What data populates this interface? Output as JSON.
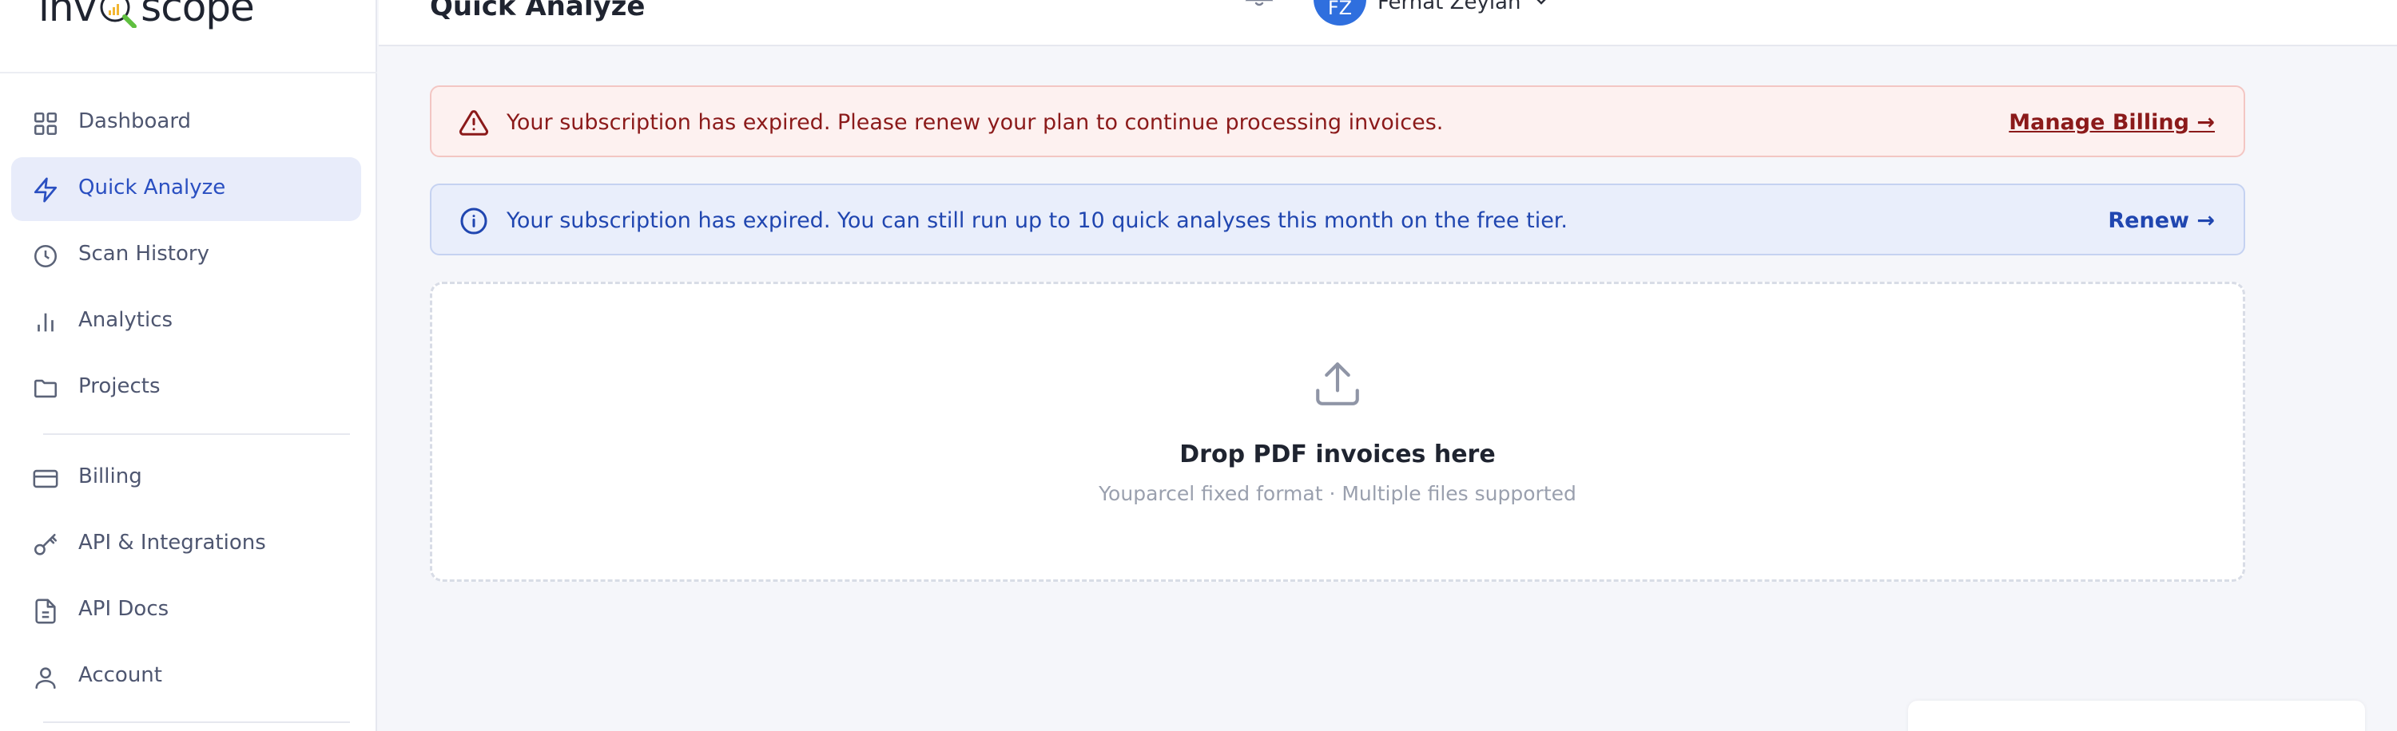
{
  "app": {
    "logo_left": "inv",
    "logo_right": "scope"
  },
  "header": {
    "title": "Quick Analyze",
    "user": {
      "initials": "FZ",
      "name": "Ferhat Zeylan"
    }
  },
  "sidebar": {
    "items": [
      {
        "label": "Dashboard",
        "icon": "grid-icon"
      },
      {
        "label": "Quick Analyze",
        "icon": "bolt-icon",
        "active": true
      },
      {
        "label": "Scan History",
        "icon": "clock-icon"
      },
      {
        "label": "Analytics",
        "icon": "bar-chart-icon"
      },
      {
        "label": "Projects",
        "icon": "folder-icon"
      },
      {
        "label": "Billing",
        "icon": "credit-card-icon"
      },
      {
        "label": "API & Integrations",
        "icon": "key-icon"
      },
      {
        "label": "API Docs",
        "icon": "document-icon"
      },
      {
        "label": "Account",
        "icon": "user-icon"
      }
    ]
  },
  "banners": {
    "error": {
      "text": "Your subscription has expired. Please renew your plan to continue processing invoices.",
      "link": "Manage Billing →"
    },
    "info": {
      "text": "Your subscription has expired. You can still run up to 10 quick analyses this month on the free tier.",
      "link": "Renew →"
    }
  },
  "dropzone": {
    "title": "Drop PDF invoices here",
    "subtitle": "Youparcel fixed format · Multiple files supported"
  },
  "colors": {
    "accent": "#2a4fc1",
    "error_bg": "#fdf1f0",
    "error_text": "#8b1a1a",
    "info_bg": "#e9eefb",
    "info_text": "#2046b0",
    "avatar": "#2f6fde"
  }
}
